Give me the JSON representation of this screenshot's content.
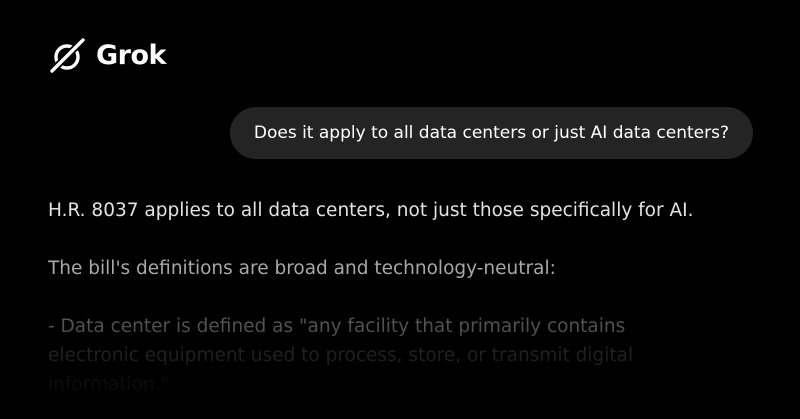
{
  "brand": {
    "name": "Grok",
    "logo_icon": "grok-logo-icon"
  },
  "colors": {
    "background": "#000000",
    "user_bubble": "#242424",
    "text_primary": "#ffffff"
  },
  "conversation": {
    "user_message": "Does it apply to all data centers or just AI data centers?",
    "assistant": {
      "paragraph_1": "H.R. 8037 applies to all data centers, not just those specifically for AI.",
      "paragraph_2": "The bill's definitions are broad and technology-neutral:",
      "paragraph_3_line_1": "- Data center is defined as \"any facility that primarily contains",
      "paragraph_3_line_2": "electronic equipment used to process, store, or transmit digital",
      "paragraph_3_line_3": "information.\""
    }
  }
}
